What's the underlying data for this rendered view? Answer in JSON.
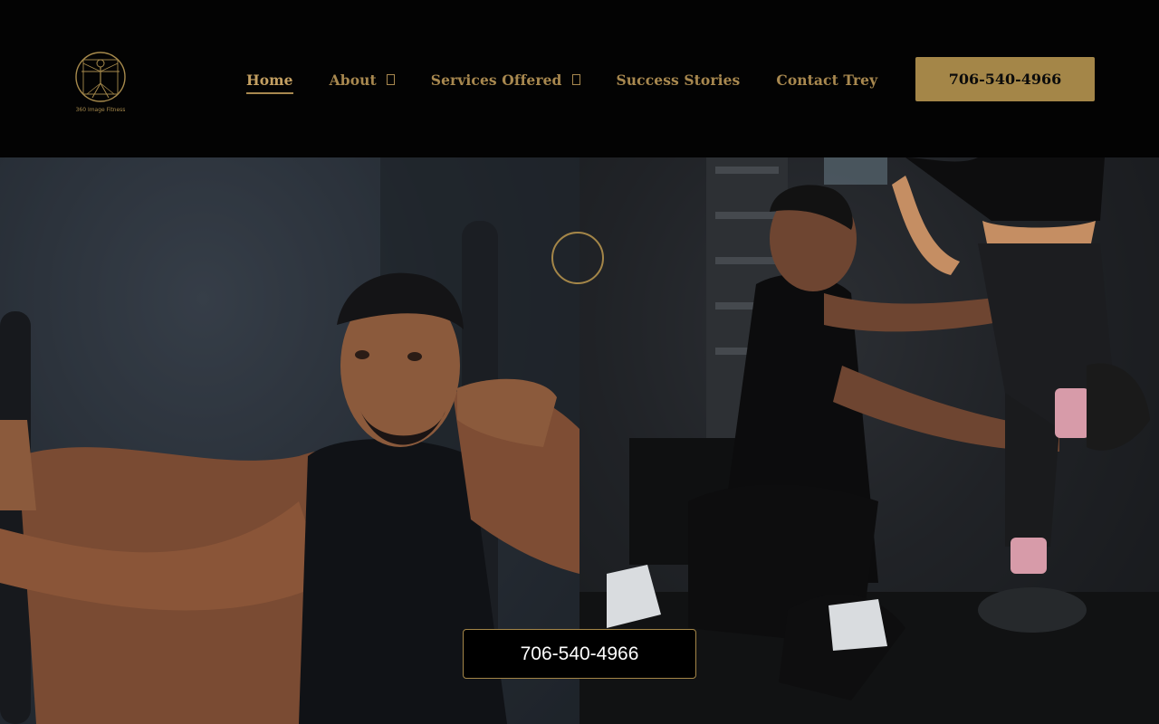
{
  "brand": {
    "logo_icon": "vitruvian-man-icon",
    "logo_text": "360 Image Fitness"
  },
  "nav": {
    "items": [
      {
        "label": "Home",
        "active": true,
        "has_dropdown": false
      },
      {
        "label": "About",
        "active": false,
        "has_dropdown": true
      },
      {
        "label": "Services Offered",
        "active": false,
        "has_dropdown": true
      },
      {
        "label": "Success Stories",
        "active": false,
        "has_dropdown": false
      },
      {
        "label": "Contact Trey",
        "active": false,
        "has_dropdown": false
      }
    ]
  },
  "header_cta": {
    "label": "706-540-4966"
  },
  "hero": {
    "left_photo": "trainer-portrait-photo",
    "right_photo": "trainer-coaching-client-photo",
    "center_marker": "gold-ring-icon",
    "phone_button_label": "706-540-4966"
  },
  "colors": {
    "accent_gold": "#a48648",
    "background": "#030303",
    "button_text": "#0b0b0b"
  }
}
